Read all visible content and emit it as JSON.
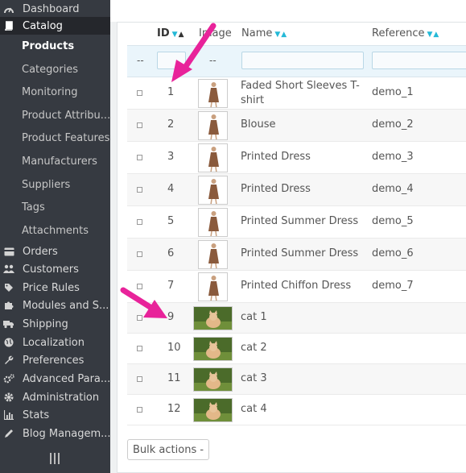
{
  "sidebar": {
    "top_items": [
      {
        "label": "Dashboard",
        "icon": "dashboard-icon"
      },
      {
        "label": "Catalog",
        "icon": "book-icon",
        "active": true
      }
    ],
    "catalog_sub": [
      {
        "label": "Products",
        "active": true
      },
      {
        "label": "Categories"
      },
      {
        "label": "Monitoring"
      },
      {
        "label": "Product Attribu..."
      },
      {
        "label": "Product Features"
      },
      {
        "label": "Manufacturers"
      },
      {
        "label": "Suppliers"
      },
      {
        "label": "Tags"
      },
      {
        "label": "Attachments"
      }
    ],
    "items": [
      {
        "label": "Orders",
        "icon": "credit-card-icon"
      },
      {
        "label": "Customers",
        "icon": "users-icon"
      },
      {
        "label": "Price Rules",
        "icon": "tag-icon"
      },
      {
        "label": "Modules and S...",
        "icon": "puzzle-icon"
      },
      {
        "label": "Shipping",
        "icon": "truck-icon"
      },
      {
        "label": "Localization",
        "icon": "globe-icon"
      },
      {
        "label": "Preferences",
        "icon": "wrench-icon"
      },
      {
        "label": "Advanced Para...",
        "icon": "cogs-icon"
      },
      {
        "label": "Administration",
        "icon": "gear-icon"
      },
      {
        "label": "Stats",
        "icon": "bar-chart-icon"
      },
      {
        "label": "Blog Managem...",
        "icon": "pencil-icon"
      }
    ]
  },
  "table": {
    "columns": {
      "id": "ID",
      "image": "Image",
      "name": "Name",
      "reference": "Reference"
    },
    "filter_placeholders": {
      "bulk": "--",
      "image": "--"
    },
    "rows": [
      {
        "id": "1",
        "name": "Faded Short Sleeves T-shirt",
        "reference": "demo_1",
        "thumb": "dress"
      },
      {
        "id": "2",
        "name": "Blouse",
        "reference": "demo_2",
        "thumb": "dress"
      },
      {
        "id": "3",
        "name": "Printed Dress",
        "reference": "demo_3",
        "thumb": "dress"
      },
      {
        "id": "4",
        "name": "Printed Dress",
        "reference": "demo_4",
        "thumb": "dress"
      },
      {
        "id": "5",
        "name": "Printed Summer Dress",
        "reference": "demo_5",
        "thumb": "dress"
      },
      {
        "id": "6",
        "name": "Printed Summer Dress",
        "reference": "demo_6",
        "thumb": "dress"
      },
      {
        "id": "7",
        "name": "Printed Chiffon Dress",
        "reference": "demo_7",
        "thumb": "dress"
      },
      {
        "id": "9",
        "name": "cat 1",
        "reference": "",
        "thumb": "cat"
      },
      {
        "id": "10",
        "name": "cat 2",
        "reference": "",
        "thumb": "cat"
      },
      {
        "id": "11",
        "name": "cat 3",
        "reference": "",
        "thumb": "cat"
      },
      {
        "id": "12",
        "name": "cat 4",
        "reference": "",
        "thumb": "cat"
      }
    ]
  },
  "bulk_actions_label": "Bulk actions -",
  "colors": {
    "sidebar_bg": "#363a41",
    "accent": "#25b9d7",
    "annotation_arrow": "#e8239a"
  }
}
